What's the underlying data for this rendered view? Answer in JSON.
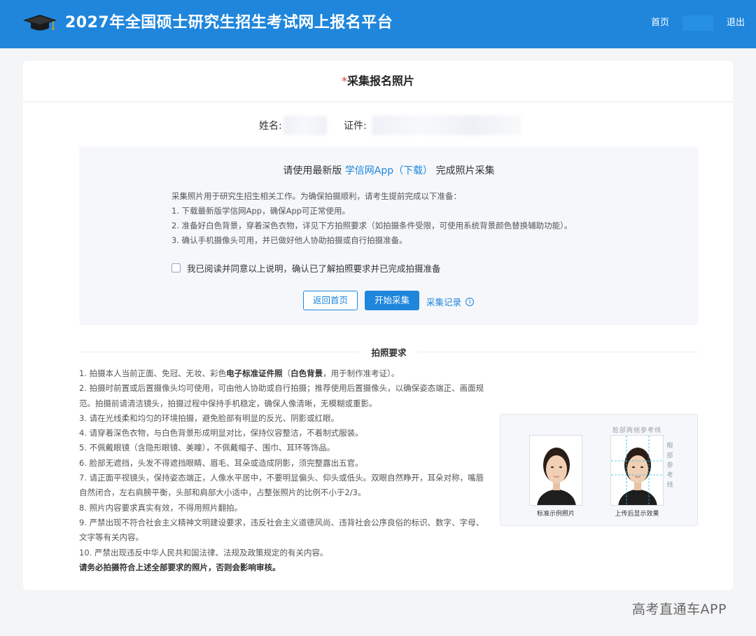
{
  "header": {
    "title": "2027年全国硕士研究生招生考试网上报名平台",
    "nav_home": "首页",
    "nav_logout": "退出",
    "brand_color": "#1f86dc"
  },
  "card": {
    "required_mark": "*",
    "title": "采集报名照片",
    "name_label": "姓名:",
    "id_label": "证件:"
  },
  "panel": {
    "title_prefix": "请使用最新版 ",
    "app_link": "学信网App（下载）",
    "title_suffix": " 完成照片采集",
    "instructions": [
      "采集照片用于研究生招生相关工作。为确保拍摄顺利，请考生提前完成以下准备：",
      "1. 下载最新版学信网App，确保App可正常使用。",
      "2. 准备好白色背景，穿着深色衣物，详见下方拍照要求（如拍摄条件受限，可使用系统背景颜色替换辅助功能）。",
      "3. 确认手机摄像头可用，并已做好他人协助拍摄或自行拍摄准备。"
    ],
    "agree_text": "我已阅读并同意以上说明，确认已了解拍照要求并已完成拍摄准备",
    "back_button": "返回首页",
    "start_button": "开始采集",
    "record_link": "采集记录",
    "info_icon": "i"
  },
  "requirements": {
    "title": "拍照要求",
    "item1_pre": "1. 拍摄本人当前正面、免冠、无妆、彩色",
    "item1_bold1": "电子标准证件照",
    "item1_mid": "（",
    "item1_bold2": "白色背景",
    "item1_post": "，用于制作准考证）。",
    "items": [
      "2. 拍摄时前置或后置摄像头均可使用，可由他人协助或自行拍摄；推荐使用后置摄像头，以确保姿态端正、画面规范。拍摄前请清洁镜头，拍摄过程中保持手机稳定，确保人像清晰，无模糊或重影。",
      "3. 请在光线柔和均匀的环境拍摄，避免脸部有明显的反光、阴影或红眼。",
      "4. 请穿着深色衣物，与白色背景形成明显对比，保持仪容整洁，不着制式服装。",
      "5. 不佩戴眼镜（含隐形眼镜、美瞳），不佩戴帽子、围巾、耳环等饰品。",
      "6. 脸部无遮挡，头发不得遮挡眼睛、眉毛、耳朵或造成阴影，须完整露出五官。",
      "7. 请正面平视镜头，保持姿态端正，人像水平居中，不要明显偏头、仰头或低头。双眼自然睁开，耳朵对称，嘴唇自然闭合，左右肩膀平衡，头部和肩部大小适中，占整张照片的比例不小于2/3。",
      "8. 照片内容要求真实有效，不得用照片翻拍。",
      "9. 严禁出现不符合社会主义精神文明建设要求，违反社会主义道德风尚、违背社会公序良俗的标识、数字、字母、文字等有关内容。",
      "10. 严禁出现违反中华人民共和国法律、法规及政策规定的有关内容。"
    ],
    "final_note": "请务必拍摄符合上述全部要求的照片，否则会影响审核。"
  },
  "sample": {
    "caption_standard": "标准示例照片",
    "caption_upload": "上传后显示效果",
    "ref_top": "脸部两侧参考线",
    "ref_side": [
      "眼",
      "部",
      "参",
      "考",
      "线"
    ]
  },
  "watermark": "高考直通车APP"
}
